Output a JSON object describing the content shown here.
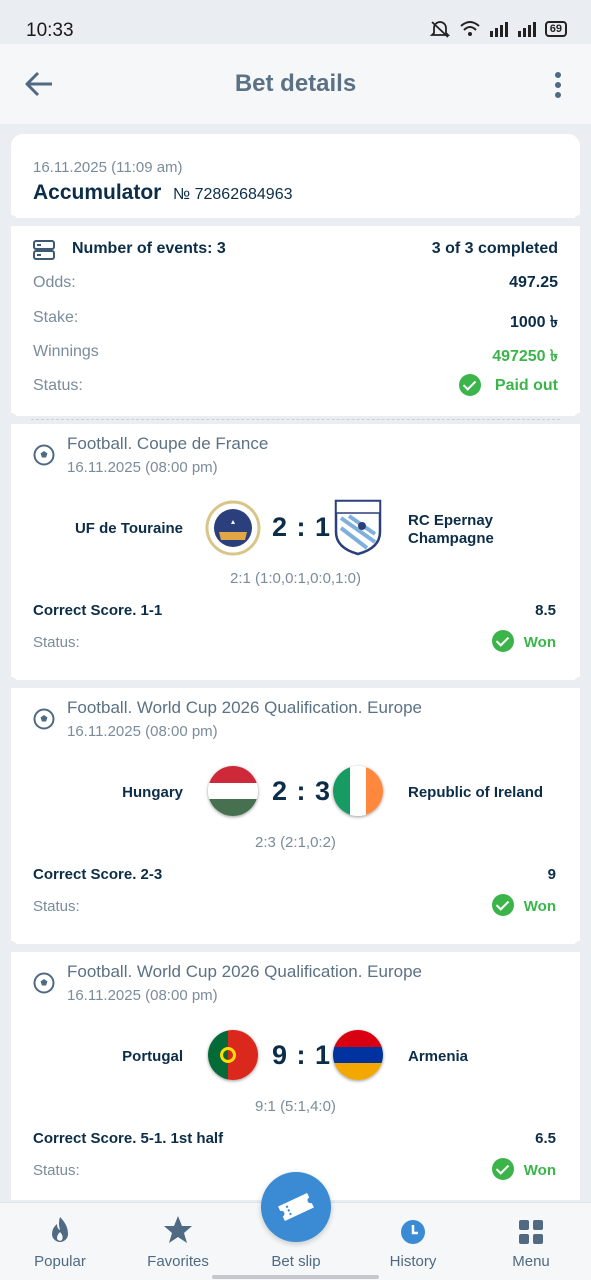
{
  "statusbar": {
    "time": "10:33",
    "battery": "69"
  },
  "header": {
    "title": "Bet details"
  },
  "summary": {
    "date": "16.11.2025 (11:09 am)",
    "type": "Accumulator",
    "number": "№ 72862684963",
    "events_label": "Number of events: 3",
    "completed": "3 of 3 completed",
    "odds_label": "Odds:",
    "odds_value": "497.25",
    "stake_label": "Stake:",
    "stake_value": "1000 ৳",
    "winnings_label": "Winnings",
    "winnings_value": "497250 ৳",
    "status_label": "Status:",
    "status_value": "Paid out"
  },
  "events": [
    {
      "league": "Football. Coupe de France",
      "date": "16.11.2025 (08:00 pm)",
      "home": "UF de Touraine",
      "away_line1": "RC Epernay",
      "away_line2": "Champagne",
      "score": "2 : 1",
      "details": "2:1 (1:0,0:1,0:0,1:0)",
      "market": "Correct Score. 1-1",
      "odds": "8.5",
      "status_label": "Status:",
      "status": "Won"
    },
    {
      "league": "Football. World Cup 2026 Qualification. Europe",
      "date": "16.11.2025 (08:00 pm)",
      "home": "Hungary",
      "away_line1": "Republic of Ireland",
      "away_line2": "",
      "score": "2 : 3",
      "details": "2:3 (2:1,0:2)",
      "market": "Correct Score. 2-3",
      "odds": "9",
      "status_label": "Status:",
      "status": "Won"
    },
    {
      "league": "Football. World Cup 2026 Qualification. Europe",
      "date": "16.11.2025 (08:00 pm)",
      "home": "Portugal",
      "away_line1": "Armenia",
      "away_line2": "",
      "score": "9 : 1",
      "details": "9:1 (5:1,4:0)",
      "market": "Correct Score. 5-1. 1st half",
      "odds": "6.5",
      "status_label": "Status:",
      "status": "Won"
    }
  ],
  "nav": {
    "popular": "Popular",
    "favorites": "Favorites",
    "betslip": "Bet slip",
    "history": "History",
    "menu": "Menu"
  },
  "colors": {
    "accent": "#3a8bd4",
    "won": "#3bb54a",
    "text": "#0c2d48"
  }
}
